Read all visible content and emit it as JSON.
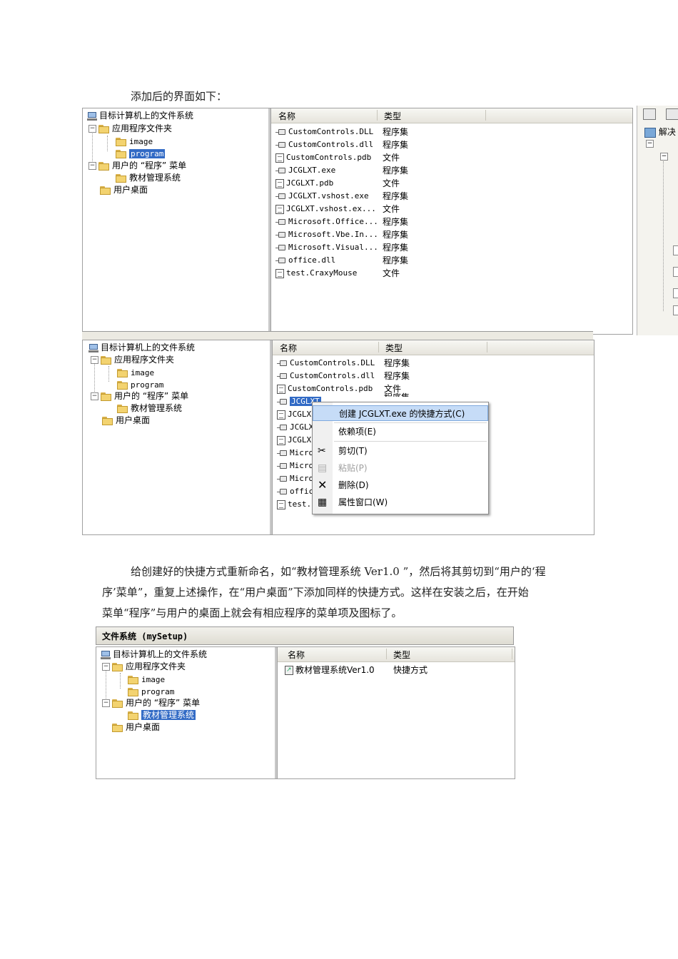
{
  "para1": "添加后的界面如下：",
  "para2": {
    "line1": "给创建好的快捷方式重新命名，如“教材管理系统 Ver1.0 ”，然后将其剪切到“用户的‘程",
    "line2": "序’菜单”，重复上述操作，在“用户桌面”下添加同样的快捷方式。这样在安装之后，在开始",
    "line3": "菜单“程序”与用户的桌面上就会有相应程序的菜单项及图标了。"
  },
  "tree": {
    "root": "目标计算机上的文件系统",
    "app_folder": "应用程序文件夹",
    "image": "image",
    "program": "program",
    "programs_menu": "用户的 “程序” 菜单",
    "jcgl": "教材管理系统",
    "desktop": "用户桌面"
  },
  "list": {
    "col_name": "名称",
    "col_type": "类型",
    "files": [
      {
        "name": "CustomControls.DLL",
        "type": "程序集",
        "icon": "assembly-icon"
      },
      {
        "name": "CustomControls.dll",
        "type": "程序集",
        "icon": "assembly-icon"
      },
      {
        "name": "CustomControls.pdb",
        "type": "文件",
        "icon": "document-icon"
      },
      {
        "name": "JCGLXT.exe",
        "type": "程序集",
        "icon": "assembly-icon"
      },
      {
        "name": "JCGLXT.pdb",
        "type": "文件",
        "icon": "document-icon"
      },
      {
        "name": "JCGLXT.vshost.exe",
        "type": "程序集",
        "icon": "assembly-icon"
      },
      {
        "name": "JCGLXT.vshost.ex...",
        "type": "文件",
        "icon": "document-icon"
      },
      {
        "name": "Microsoft.Office...",
        "type": "程序集",
        "icon": "assembly-icon"
      },
      {
        "name": "Microsoft.Vbe.In...",
        "type": "程序集",
        "icon": "assembly-icon"
      },
      {
        "name": "Microsoft.Visual...",
        "type": "程序集",
        "icon": "assembly-icon"
      },
      {
        "name": "office.dll",
        "type": "程序集",
        "icon": "assembly-icon"
      },
      {
        "name": "test.CraxyMouse",
        "type": "文件",
        "icon": "document-icon"
      }
    ]
  },
  "shot2": {
    "truncated_names": [
      "JCGLXT",
      "JCGLX",
      "JCGLX",
      "JCGLX",
      "Micro",
      "Micro",
      "Micro",
      "offic",
      "test."
    ],
    "partial_type": "程序集"
  },
  "context_menu": {
    "create_shortcut": "创建 JCGLXT.exe 的快捷方式(C)",
    "dependencies": "依赖项(E)",
    "cut": "剪切(T)",
    "paste": "粘贴(P)",
    "delete": "删除(D)",
    "properties": "属性窗口(W)"
  },
  "shot3": {
    "title": "文件系统 (mySetup)",
    "shortcut_name": "教材管理系统Ver1.0",
    "shortcut_type": "快捷方式"
  },
  "side": {
    "label": "解决"
  }
}
